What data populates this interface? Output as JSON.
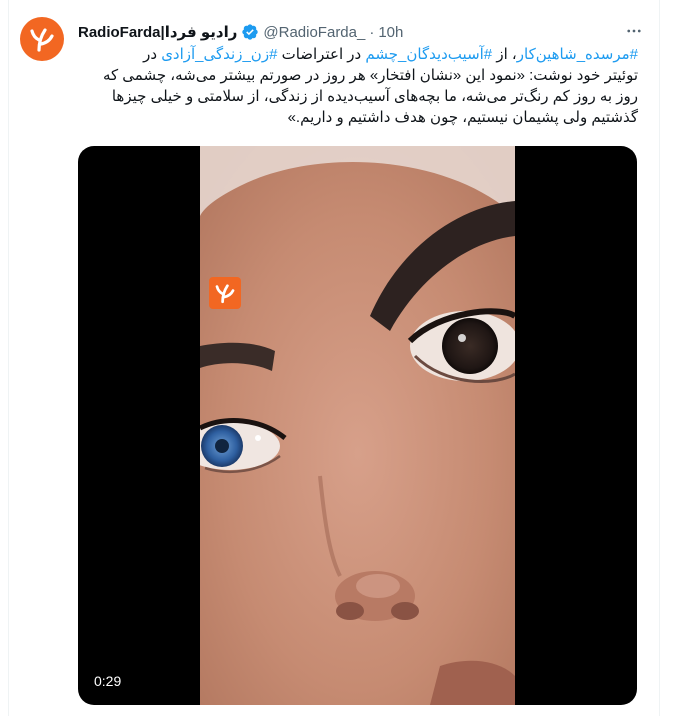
{
  "tweet": {
    "display_name": "RadioFarda|رادیو فردا",
    "handle": "@RadioFarda_",
    "separator": "·",
    "time": "10h",
    "text_lines": [
      [
        {
          "t": "#مرسده_شاهین‌کار",
          "tag": true
        },
        {
          "t": "، از ",
          "tag": false
        },
        {
          "t": "#آسیب‌دیدگان_چشم",
          "tag": true
        },
        {
          "t": " در اعتراضات ",
          "tag": false
        },
        {
          "t": "#زن_زندگی_آزادی",
          "tag": true
        },
        {
          "t": " در",
          "tag": false
        }
      ],
      [
        {
          "t": "توئیتر خود نوشت: «نمود این «نشان افتخار» هر روز در صورتم بیشتر می‌شه، چشمی که",
          "tag": false
        }
      ],
      [
        {
          "t": "روز به روز کم رنگ‌تر می‌شه، ما بچه‌های آسیب‌دیده از زندگی، از سلامتی و خیلی چیزها",
          "tag": false
        }
      ],
      [
        {
          "t": "گذشتیم ولی پشیمان نیستیم، چون هدف داشتیم و داریم.»",
          "tag": false
        }
      ]
    ]
  },
  "media": {
    "video_duration": "0:29"
  },
  "colors": {
    "brand_orange": "#f26722",
    "link_blue": "#1d9bf0",
    "verified_blue": "#1d9bf0",
    "muted_text": "#536471"
  },
  "icons": {
    "avatar": "radiofarda-logo-icon",
    "verified": "verified-badge-icon",
    "more": "more-options-icon",
    "watermark": "radiofarda-watermark-icon"
  }
}
